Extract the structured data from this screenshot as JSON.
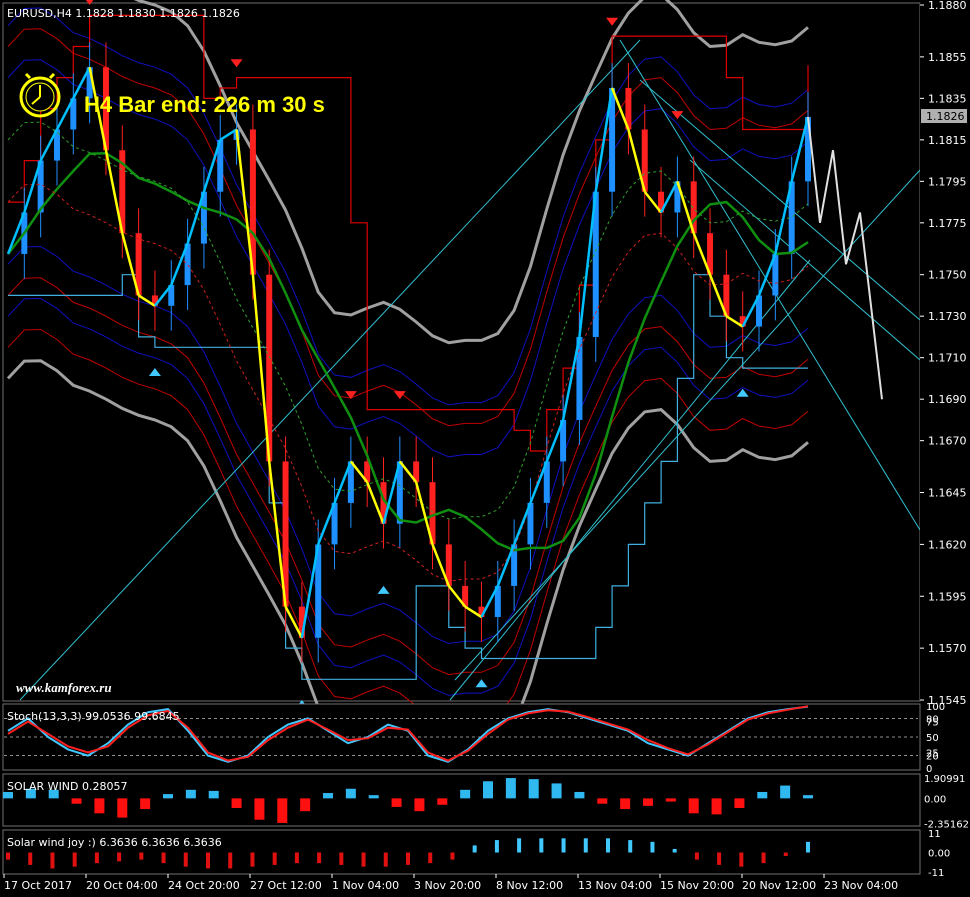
{
  "window": {
    "symbol_header": "EURUSD,H4  1.1828 1.1830 1.1826 1.1826",
    "current_price": "1.1826"
  },
  "hud": {
    "bar_end_text": "H4 Bar end: 226 m 30 s",
    "clock_icon": "clock-icon"
  },
  "watermark": "www.kamforex.ru",
  "colors": {
    "background": "#000000",
    "bull_candle": "#1e90ff",
    "bear_candle": "#ff2020",
    "yellow_line": "#ffff00",
    "cyan_line": "#00bfff",
    "green_ma": "#109010",
    "gray_band": "#a0a0a0",
    "blue_band": "#1010c0",
    "red_band": "#c00000",
    "grid": "#404040"
  },
  "chart_data": [
    {
      "type": "line",
      "title": "EURUSD,H4  1.1828 1.1830 1.1826 1.1826",
      "ylim": [
        1.1545,
        1.188
      ],
      "y_ticks": [
        "1.1880",
        "1.1855",
        "1.1835",
        "1.1815",
        "1.1795",
        "1.1775",
        "1.1750",
        "1.1730",
        "1.1710",
        "1.1690",
        "1.1670",
        "1.1645",
        "1.1620",
        "1.1595",
        "1.1570",
        "1.1545"
      ],
      "x_ticks": [
        "17 Oct 2017",
        "20 Oct 04:00",
        "24 Oct 20:00",
        "27 Oct 12:00",
        "1 Nov 04:00",
        "3 Nov 20:00",
        "8 Nov 12:00",
        "13 Nov 04:00",
        "15 Nov 20:00",
        "20 Nov 12:00",
        "23 Nov 04:00"
      ],
      "series": [
        {
          "values": [
            1.176,
            1.178,
            1.1805,
            1.182,
            1.1835,
            1.185,
            1.181,
            1.177,
            1.174,
            1.1735,
            1.1745,
            1.1765,
            1.179,
            1.1815,
            1.182,
            1.175,
            1.166,
            1.159,
            1.1575,
            1.162,
            1.164,
            1.166,
            1.165,
            1.163,
            1.166,
            1.165,
            1.162,
            1.16,
            1.159,
            1.1585,
            1.16,
            1.162,
            1.164,
            1.166,
            1.168,
            1.172,
            1.179,
            1.184,
            1.182,
            1.179,
            1.178,
            1.1795,
            1.177,
            1.175,
            1.173,
            1.1725,
            1.174,
            1.176,
            1.1795,
            1.1826
          ]
        }
      ]
    },
    {
      "type": "line",
      "title": "Stoch(13,3,3) 99.0536 99.6845",
      "ylim": [
        0,
        100
      ],
      "y_ticks": [
        "100",
        "80",
        "75",
        "50",
        "25",
        "20",
        "0"
      ],
      "series": [
        {
          "values": [
            60,
            80,
            50,
            30,
            20,
            40,
            70,
            90,
            95,
            60,
            20,
            10,
            20,
            50,
            70,
            80,
            60,
            40,
            50,
            70,
            60,
            20,
            10,
            30,
            60,
            80,
            90,
            95,
            90,
            80,
            70,
            60,
            40,
            30,
            20,
            40,
            60,
            80,
            90,
            95,
            99
          ]
        },
        {
          "values": [
            55,
            75,
            55,
            35,
            25,
            35,
            65,
            85,
            92,
            65,
            25,
            12,
            18,
            45,
            65,
            78,
            62,
            45,
            48,
            65,
            62,
            25,
            12,
            28,
            55,
            78,
            88,
            93,
            91,
            82,
            72,
            62,
            45,
            32,
            22,
            38,
            58,
            78,
            88,
            94,
            99.7
          ]
        }
      ]
    },
    {
      "type": "bar",
      "title": "SOLAR WIND 0.28057",
      "y_ticks": [
        "1.90991",
        "0.00",
        "-2.35162"
      ],
      "series": [
        {
          "values": [
            0.6,
            0.9,
            0.8,
            -0.5,
            -1.4,
            -1.8,
            -1.0,
            0.4,
            0.8,
            0.7,
            -0.9,
            -2.0,
            -2.3,
            -1.2,
            0.5,
            0.9,
            0.3,
            -0.8,
            -1.2,
            -0.6,
            0.8,
            1.6,
            1.9,
            1.8,
            1.4,
            0.6,
            -0.5,
            -1.0,
            -0.7,
            -0.3,
            -1.4,
            -1.5,
            -0.9,
            0.6,
            1.2,
            0.3
          ]
        }
      ]
    },
    {
      "type": "bar",
      "title": "Solar wind joy :) 6.3636 6.3636 6.3636",
      "y_ticks": [
        "11",
        "0.00",
        "-11"
      ],
      "series": [
        {
          "values": [
            -4,
            -7,
            -9,
            -8,
            -6,
            -5,
            -4,
            -6,
            -8,
            -9,
            -9,
            -8,
            -7,
            -6,
            -6,
            -7,
            -8,
            -8,
            -7,
            -6,
            -4,
            4,
            7,
            8,
            8,
            8,
            8,
            8,
            7,
            6,
            2,
            -4,
            -7,
            -8,
            -6,
            -2,
            6
          ]
        }
      ]
    }
  ]
}
